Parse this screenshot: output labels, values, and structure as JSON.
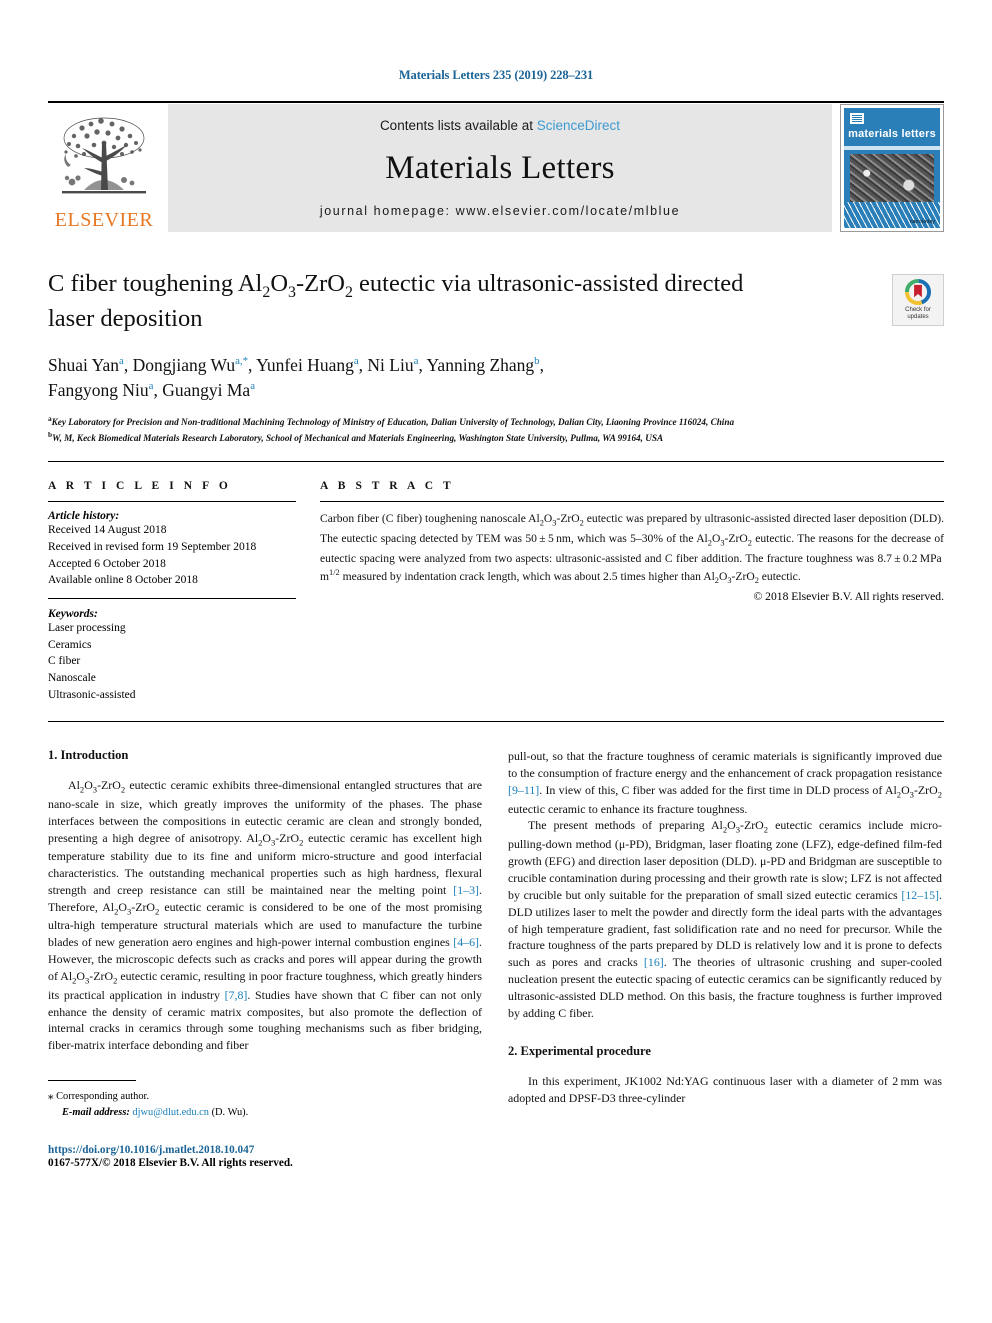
{
  "running_head": "Materials Letters 235 (2019) 228–231",
  "masthead": {
    "publisher_name": "ELSEVIER",
    "contents_prefix": "Contents lists available at ",
    "sciencedirect": "ScienceDirect",
    "journal_title": "Materials Letters",
    "homepage": "journal homepage: www.elsevier.com/locate/mlblue",
    "cover": {
      "title": "materials letters",
      "footer_mark": "nanotoday"
    }
  },
  "article": {
    "title_line1_pre": "C fiber toughening Al",
    "title_full": "C fiber toughening Al2O3-ZrO2 eutectic via ultrasonic-assisted directed laser deposition",
    "crossmark": {
      "line1": "Check for",
      "line2": "updates"
    },
    "authors": [
      {
        "name": "Shuai Yan",
        "marks": "a"
      },
      {
        "name": "Dongjiang Wu",
        "marks": "a,*"
      },
      {
        "name": "Yunfei Huang",
        "marks": "a"
      },
      {
        "name": "Ni Liu",
        "marks": "a"
      },
      {
        "name": "Yanning Zhang",
        "marks": "b"
      },
      {
        "name": "Fangyong Niu",
        "marks": "a"
      },
      {
        "name": "Guangyi Ma",
        "marks": "a"
      }
    ],
    "affiliations": [
      {
        "mark": "a",
        "text": "Key Laboratory for Precision and Non-traditional Machining Technology of Ministry of Education, Dalian University of Technology, Dalian City, Liaoning Province 116024, China"
      },
      {
        "mark": "b",
        "text": "W, M, Keck Biomedical Materials Research Laboratory, School of Mechanical and Materials Engineering, Washington State University, Pullma, WA 99164, USA"
      }
    ]
  },
  "article_info": {
    "heading": "A R T I C L E   I N F O",
    "history_label": "Article history:",
    "history": [
      "Received 14 August 2018",
      "Received in revised form 19 September 2018",
      "Accepted 6 October 2018",
      "Available online 8 October 2018"
    ],
    "keywords_label": "Keywords:",
    "keywords": [
      "Laser processing",
      "Ceramics",
      "C fiber",
      "Nanoscale",
      "Ultrasonic-assisted"
    ]
  },
  "abstract": {
    "heading": "A B S T R A C T",
    "copyright": "© 2018 Elsevier B.V. All rights reserved."
  },
  "sections": {
    "introduction_heading": "1. Introduction",
    "experimental_heading": "2. Experimental procedure"
  },
  "footnote": {
    "star": "⁎",
    "corresponding": "Corresponding author.",
    "email_label": "E-mail address:",
    "email": "djwu@dlut.edu.cn",
    "email_owner": "(D. Wu)."
  },
  "footer": {
    "doi": "https://doi.org/10.1016/j.matlet.2018.10.047",
    "issn": "0167-577X/© 2018 Elsevier B.V. All rights reserved."
  },
  "colors": {
    "link": "#1a7fba",
    "running_head": "#1a6496",
    "elsevier_orange": "#E87722",
    "cover_blue": "#2a7fb8"
  }
}
